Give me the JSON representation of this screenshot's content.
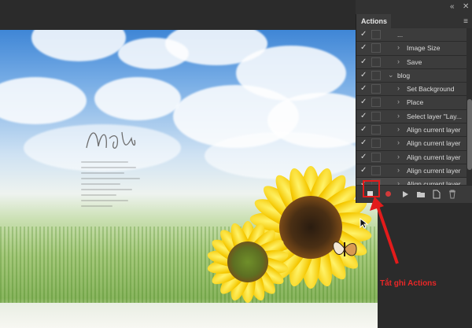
{
  "panel": {
    "title": "Actions",
    "menu_icon": "menu-icon",
    "collapse_icon": "double-chevron-icon",
    "close_icon": "close-icon",
    "rows": [
      {
        "check": "✓",
        "caret": "",
        "label": "...",
        "level": 1
      },
      {
        "check": "✓",
        "caret": "›",
        "label": "Image Size",
        "level": 2
      },
      {
        "check": "✓",
        "caret": "›",
        "label": "Save",
        "level": 2
      },
      {
        "check": "✓",
        "caret": "⌄",
        "label": "blog",
        "level": 1
      },
      {
        "check": "✓",
        "caret": "›",
        "label": "Set Background",
        "level": 2
      },
      {
        "check": "✓",
        "caret": "›",
        "label": "Place",
        "level": 2
      },
      {
        "check": "✓",
        "caret": "›",
        "label": "Select layer \"Lay...",
        "level": 2
      },
      {
        "check": "✓",
        "caret": "›",
        "label": "Align current layer",
        "level": 2
      },
      {
        "check": "✓",
        "caret": "›",
        "label": "Align current layer",
        "level": 2
      },
      {
        "check": "✓",
        "caret": "›",
        "label": "Align current layer",
        "level": 2
      },
      {
        "check": "✓",
        "caret": "›",
        "label": "Align current layer",
        "level": 2
      },
      {
        "check": "✓",
        "caret": "›",
        "label": "Align current layer",
        "level": 2,
        "selected": true
      }
    ],
    "toolbar": [
      {
        "name": "stop-button",
        "icon": "stop-icon"
      },
      {
        "name": "record-button",
        "icon": "record-icon"
      },
      {
        "name": "play-button",
        "icon": "play-icon"
      },
      {
        "name": "new-set-button",
        "icon": "folder-icon"
      },
      {
        "name": "new-action-button",
        "icon": "new-page-icon"
      },
      {
        "name": "delete-button",
        "icon": "trash-icon"
      }
    ]
  },
  "annotation": {
    "text": "Tắt ghi Actions",
    "color": "#e92727"
  },
  "colors": {
    "panel_bg": "#3c3c3c",
    "highlight": "#e31b1b"
  }
}
